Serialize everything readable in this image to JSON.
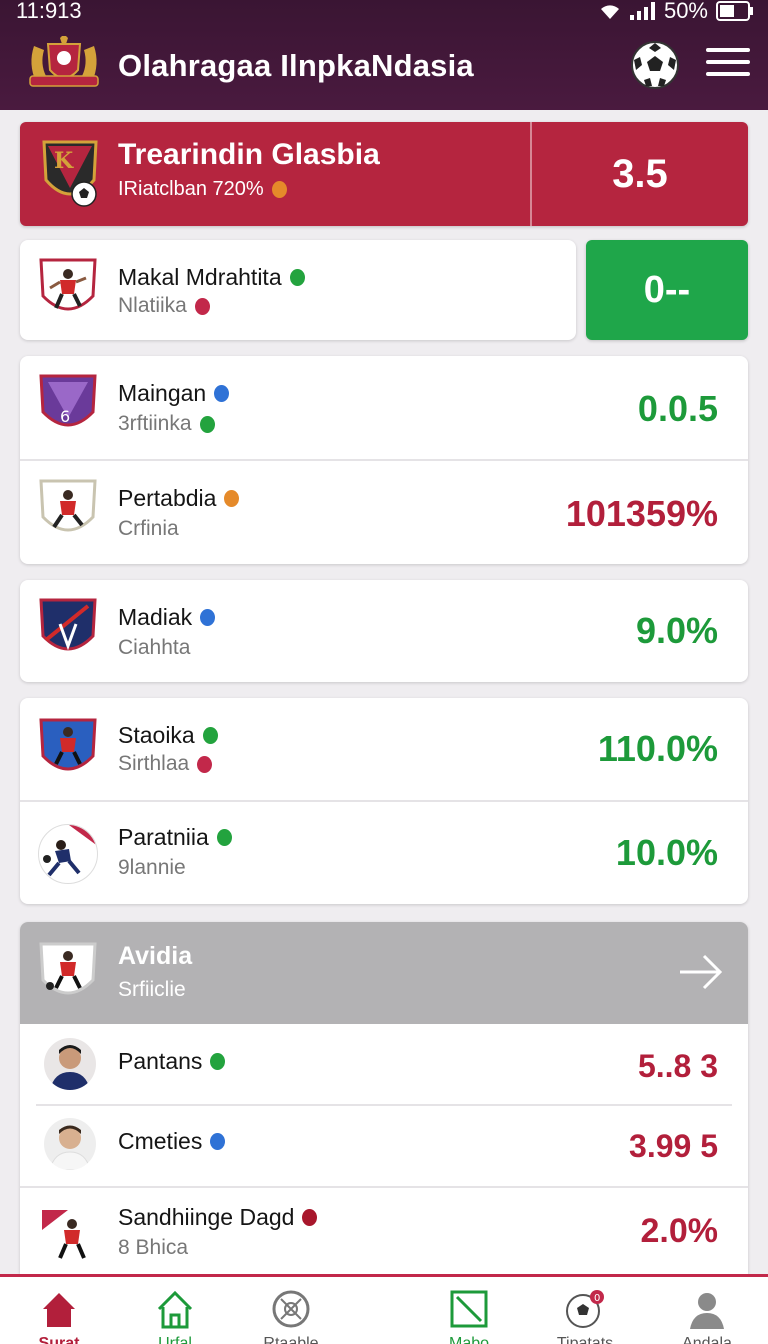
{
  "status": {
    "time": "11:913",
    "battery": "50%"
  },
  "app": {
    "title": "Olahragaa IlnpkaNdasia"
  },
  "featured": {
    "title": "Trearindin Glasbia",
    "subtitle": "IRiatclban 720%",
    "score": "3.5",
    "crest_letter": "K"
  },
  "top_card": {
    "name": "Makal Mdrahtita",
    "sub": "Nlatiika",
    "side_value": "0--"
  },
  "group1": [
    {
      "name": "Maingan",
      "sub": "3rftiinka",
      "value": "0.0.5"
    },
    {
      "name": "Pertabdia",
      "sub": "Crfinia",
      "value": "101359%"
    }
  ],
  "single": {
    "name": "Madiak",
    "sub": "Ciahhta",
    "value": "9.0%"
  },
  "group2": [
    {
      "name": "Staoika",
      "sub": "Sirthlaa",
      "value": "110.0%"
    },
    {
      "name": "Paratniia",
      "sub": "9lannie",
      "value": "10.0%"
    }
  ],
  "section": {
    "title": "Avidia",
    "subtitle": "Srfiiclie",
    "rows": [
      {
        "name": "Pantans",
        "value": "5..8 3"
      },
      {
        "name": "Cmeties",
        "value": "3.99 5"
      },
      {
        "name": "Sandhiinge Dagd",
        "sub": "8 Bhica",
        "value": "2.0%"
      }
    ]
  },
  "nav": [
    {
      "label": "Surat",
      "icon": "home-filled-icon",
      "color": "#b21f3b"
    },
    {
      "label": "Urfal",
      "icon": "home-outline-icon",
      "color": "#1d9a3a"
    },
    {
      "label": "Rtaable",
      "icon": "ball-outline-icon",
      "color": "#777777"
    },
    {
      "label": "Mabo",
      "icon": "pitch-icon",
      "color": "#1d9a3a"
    },
    {
      "label": "Tipatats",
      "icon": "football-badge-icon",
      "color": "#777777"
    },
    {
      "label": "Andala",
      "icon": "profile-icon",
      "color": "#777777"
    }
  ],
  "colors": {
    "brand_dark": "#3a1533",
    "accent_red": "#b5253f",
    "accent_green": "#1fa64a"
  }
}
